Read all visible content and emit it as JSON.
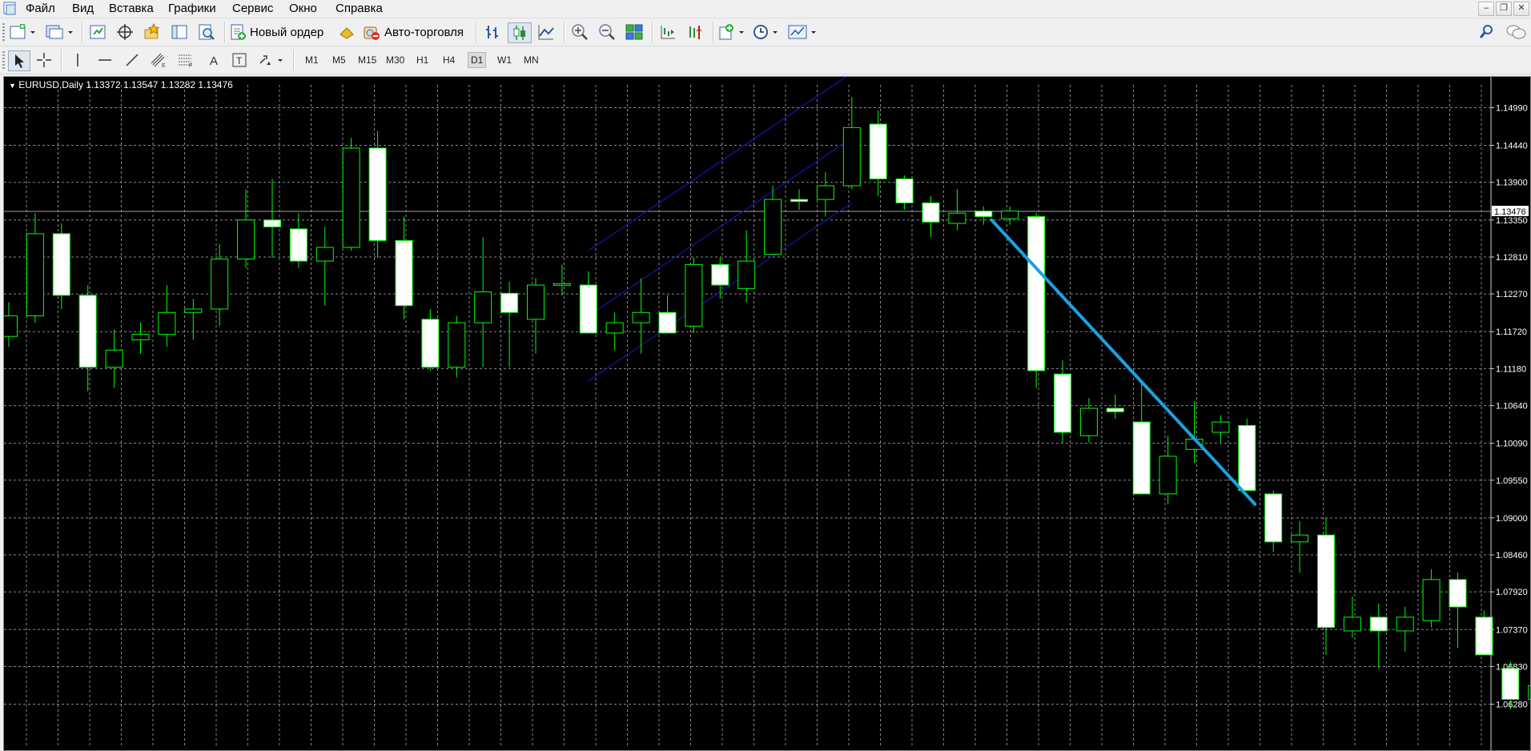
{
  "menu": {
    "items": [
      "Файл",
      "Вид",
      "Вставка",
      "Графики",
      "Сервис",
      "Окно",
      "Справка"
    ]
  },
  "toolbar": {
    "new_order_label": "Новый ордер",
    "auto_trading_label": "Авто-торговля"
  },
  "timeframes": [
    "M1",
    "M5",
    "M15",
    "M30",
    "H1",
    "H4",
    "D1",
    "W1",
    "MN"
  ],
  "active_timeframe": "D1",
  "chart": {
    "symbol_info": "EURUSD,Daily  1.13372 1.13547 1.13282 1.13476",
    "current_price_label": "1.13476",
    "price_ticks": [
      "1.14990",
      "1.14440",
      "1.13900",
      "1.13350",
      "1.12810",
      "1.12270",
      "1.11720",
      "1.11180",
      "1.10640",
      "1.10090",
      "1.09550",
      "1.09000",
      "1.08460",
      "1.07920",
      "1.07370",
      "1.06830",
      "1.06280"
    ],
    "colors": {
      "background": "#000000",
      "grid": "#8a8a8a",
      "bull_body": "#000000",
      "bear_body": "#ffffff",
      "wick": "#00ff00",
      "trendline": "#1ba1e2",
      "channel": "#1414a0",
      "axis_text": "#ffffff"
    }
  },
  "chart_data": {
    "type": "candlestick",
    "title": "EURUSD,Daily",
    "ylim": [
      1.06,
      1.155
    ],
    "current_price": 1.13476,
    "candles": [
      {
        "o": 1.1165,
        "h": 1.1215,
        "l": 1.115,
        "c": 1.1195
      },
      {
        "o": 1.1195,
        "h": 1.1345,
        "l": 1.1185,
        "c": 1.1315
      },
      {
        "o": 1.1315,
        "h": 1.133,
        "l": 1.1205,
        "c": 1.1225
      },
      {
        "o": 1.1225,
        "h": 1.124,
        "l": 1.1085,
        "c": 1.112
      },
      {
        "o": 1.112,
        "h": 1.1175,
        "l": 1.109,
        "c": 1.1145
      },
      {
        "o": 1.116,
        "h": 1.1185,
        "l": 1.114,
        "c": 1.1168
      },
      {
        "o": 1.1168,
        "h": 1.124,
        "l": 1.115,
        "c": 1.12
      },
      {
        "o": 1.12,
        "h": 1.122,
        "l": 1.116,
        "c": 1.1205
      },
      {
        "o": 1.1205,
        "h": 1.13,
        "l": 1.118,
        "c": 1.1278
      },
      {
        "o": 1.1278,
        "h": 1.138,
        "l": 1.1265,
        "c": 1.1335
      },
      {
        "o": 1.1335,
        "h": 1.1395,
        "l": 1.128,
        "c": 1.1325
      },
      {
        "o": 1.1322,
        "h": 1.1345,
        "l": 1.1265,
        "c": 1.1275
      },
      {
        "o": 1.1275,
        "h": 1.1325,
        "l": 1.121,
        "c": 1.1295
      },
      {
        "o": 1.1295,
        "h": 1.1455,
        "l": 1.129,
        "c": 1.144
      },
      {
        "o": 1.144,
        "h": 1.1465,
        "l": 1.128,
        "c": 1.1305
      },
      {
        "o": 1.1305,
        "h": 1.134,
        "l": 1.119,
        "c": 1.121
      },
      {
        "o": 1.119,
        "h": 1.1205,
        "l": 1.1115,
        "c": 1.112
      },
      {
        "o": 1.112,
        "h": 1.1195,
        "l": 1.1105,
        "c": 1.1185
      },
      {
        "o": 1.1185,
        "h": 1.131,
        "l": 1.112,
        "c": 1.123
      },
      {
        "o": 1.1228,
        "h": 1.1245,
        "l": 1.112,
        "c": 1.12
      },
      {
        "o": 1.119,
        "h": 1.125,
        "l": 1.114,
        "c": 1.124
      },
      {
        "o": 1.124,
        "h": 1.127,
        "l": 1.1225,
        "c": 1.1242
      },
      {
        "o": 1.124,
        "h": 1.126,
        "l": 1.1175,
        "c": 1.117
      },
      {
        "o": 1.117,
        "h": 1.12,
        "l": 1.1145,
        "c": 1.1185
      },
      {
        "o": 1.1185,
        "h": 1.125,
        "l": 1.114,
        "c": 1.12
      },
      {
        "o": 1.12,
        "h": 1.1225,
        "l": 1.117,
        "c": 1.117
      },
      {
        "o": 1.118,
        "h": 1.128,
        "l": 1.117,
        "c": 1.127
      },
      {
        "o": 1.127,
        "h": 1.128,
        "l": 1.122,
        "c": 1.124
      },
      {
        "o": 1.1235,
        "h": 1.132,
        "l": 1.1215,
        "c": 1.1275
      },
      {
        "o": 1.1285,
        "h": 1.1385,
        "l": 1.1285,
        "c": 1.1365
      },
      {
        "o": 1.1365,
        "h": 1.138,
        "l": 1.135,
        "c": 1.1362
      },
      {
        "o": 1.1365,
        "h": 1.1405,
        "l": 1.134,
        "c": 1.1385
      },
      {
        "o": 1.1385,
        "h": 1.1515,
        "l": 1.138,
        "c": 1.147
      },
      {
        "o": 1.1475,
        "h": 1.1495,
        "l": 1.137,
        "c": 1.1395
      },
      {
        "o": 1.1395,
        "h": 1.14,
        "l": 1.135,
        "c": 1.136
      },
      {
        "o": 1.136,
        "h": 1.137,
        "l": 1.131,
        "c": 1.1332
      },
      {
        "o": 1.133,
        "h": 1.138,
        "l": 1.132,
        "c": 1.1345
      },
      {
        "o": 1.1348,
        "h": 1.1355,
        "l": 1.1328,
        "c": 1.134
      },
      {
        "o": 1.1337,
        "h": 1.1355,
        "l": 1.1328,
        "c": 1.1348
      },
      {
        "o": 1.134,
        "h": 1.1345,
        "l": 1.109,
        "c": 1.1115
      },
      {
        "o": 1.111,
        "h": 1.113,
        "l": 1.101,
        "c": 1.1025
      },
      {
        "o": 1.102,
        "h": 1.1075,
        "l": 1.101,
        "c": 1.106
      },
      {
        "o": 1.106,
        "h": 1.108,
        "l": 1.1045,
        "c": 1.1055
      },
      {
        "o": 1.104,
        "h": 1.11,
        "l": 1.0935,
        "c": 1.0935
      },
      {
        "o": 1.0935,
        "h": 1.102,
        "l": 1.092,
        "c": 1.099
      },
      {
        "o": 1.1,
        "h": 1.107,
        "l": 1.098,
        "c": 1.1015
      },
      {
        "o": 1.1025,
        "h": 1.105,
        "l": 1.101,
        "c": 1.104
      },
      {
        "o": 1.1035,
        "h": 1.1045,
        "l": 1.094,
        "c": 1.094
      },
      {
        "o": 1.0935,
        "h": 1.094,
        "l": 1.085,
        "c": 1.0865
      },
      {
        "o": 1.0865,
        "h": 1.0895,
        "l": 1.082,
        "c": 1.0875
      },
      {
        "o": 1.0875,
        "h": 1.09,
        "l": 1.07,
        "c": 1.074
      },
      {
        "o": 1.0735,
        "h": 1.0785,
        "l": 1.0725,
        "c": 1.0755
      },
      {
        "o": 1.0755,
        "h": 1.0775,
        "l": 1.068,
        "c": 1.0735
      },
      {
        "o": 1.0735,
        "h": 1.077,
        "l": 1.0705,
        "c": 1.0755
      },
      {
        "o": 1.075,
        "h": 1.0825,
        "l": 1.074,
        "c": 1.081
      },
      {
        "o": 1.081,
        "h": 1.082,
        "l": 1.071,
        "c": 1.077
      },
      {
        "o": 1.0755,
        "h": 1.0765,
        "l": 1.07,
        "c": 1.07
      },
      {
        "o": 1.068,
        "h": 1.069,
        "l": 1.062,
        "c": 1.0635
      },
      {
        "o": 1.0635,
        "h": 1.0685,
        "l": 1.063,
        "c": 1.0655
      }
    ],
    "trendline": {
      "from_index": 37,
      "from_price": 1.1335,
      "to_index": 47,
      "to_price": 1.092
    },
    "channel": {
      "start_index": 22,
      "end_index": 32,
      "mid_start": 1.1195,
      "mid_end": 1.1455,
      "offset": 0.0095
    }
  }
}
